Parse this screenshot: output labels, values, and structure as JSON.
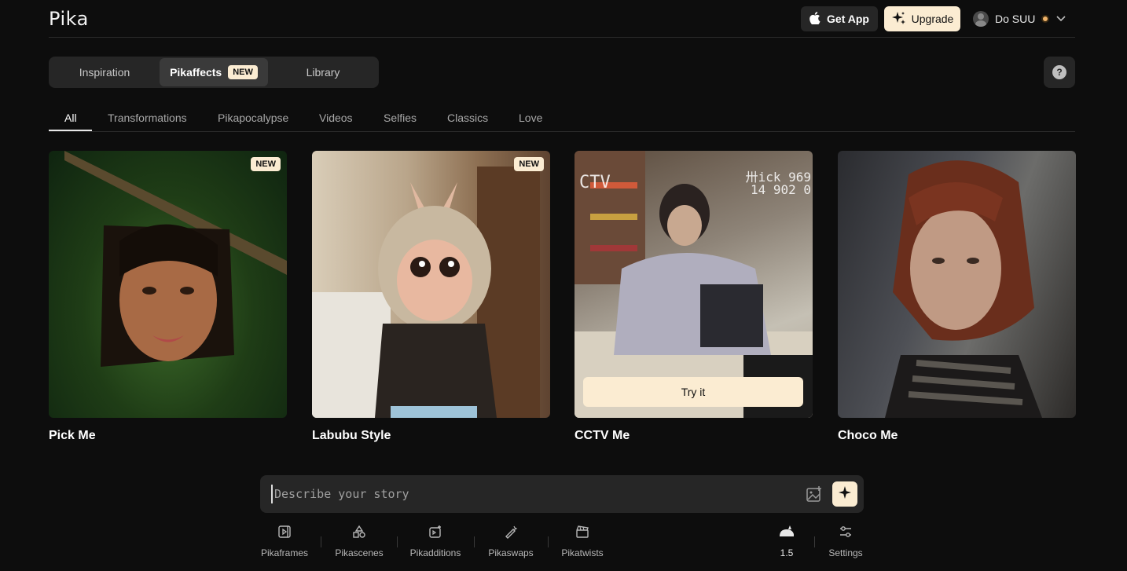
{
  "header": {
    "logo": "Pika",
    "get_app": "Get App",
    "upgrade": "Upgrade",
    "user_name": "Do SUU"
  },
  "main_tabs": [
    {
      "label": "Inspiration"
    },
    {
      "label": "Pikaffects",
      "badge": "NEW"
    },
    {
      "label": "Library"
    }
  ],
  "help_label": "?",
  "categories": [
    "All",
    "Transformations",
    "Pikapocalypse",
    "Videos",
    "Selfies",
    "Classics",
    "Love"
  ],
  "cards": [
    {
      "title": "Pick Me",
      "badge": "NEW"
    },
    {
      "title": "Labubu Style",
      "badge": "NEW"
    },
    {
      "title": "CCTV Me",
      "overlay_tl": "CTV",
      "overlay_tr1": "卅ick 969",
      "overlay_tr2": "14 902 0",
      "action": "Try it"
    },
    {
      "title": "Choco Me"
    }
  ],
  "prompt": {
    "placeholder": "Describe your story"
  },
  "toolbar": {
    "tools": [
      "Pikaframes",
      "Pikascenes",
      "Pikadditions",
      "Pikaswaps",
      "Pikatwists"
    ],
    "model": "1.5",
    "settings": "Settings"
  }
}
